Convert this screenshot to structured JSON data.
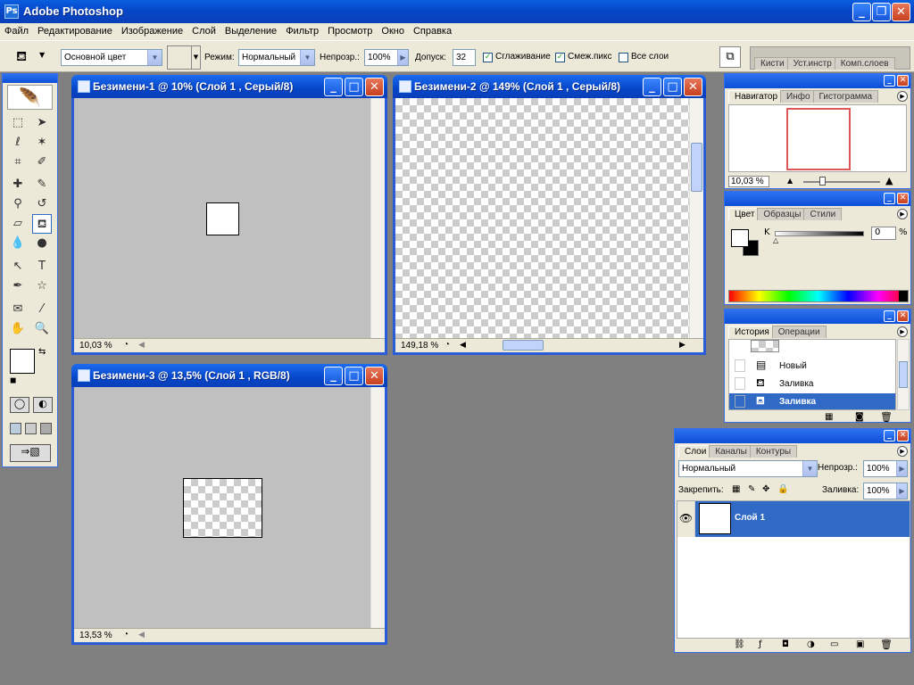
{
  "app": {
    "title": "Adobe Photoshop"
  },
  "menu": [
    "Файл",
    "Редактирование",
    "Изображение",
    "Слой",
    "Выделение",
    "Фильтр",
    "Просмотр",
    "Окно",
    "Справка"
  ],
  "options": {
    "fill_source": "Основной цвет",
    "mode_label": "Режим:",
    "mode_value": "Нормальный",
    "opacity_label": "Непрозр.:",
    "opacity_value": "100%",
    "tolerance_label": "Допуск:",
    "tolerance_value": "32",
    "antialias_label": "Сглаживание",
    "contiguous_label": "Смеж.пикс",
    "all_layers_label": "Все слои",
    "well_tabs": [
      "Кисти",
      "Уст.инстр",
      "Комп.слоев"
    ]
  },
  "documents": [
    {
      "title": "Безимени-1 @ 10% (Слой 1 , Серый/8)",
      "zoom": "10,03 %"
    },
    {
      "title": "Безимени-2 @ 149% (Слой 1 , Серый/8)",
      "zoom": "149,18 %"
    },
    {
      "title": "Безимени-3 @ 13,5% (Слой 1 , RGB/8)",
      "zoom": "13,53 %"
    }
  ],
  "navigator": {
    "tabs": [
      "Навигатор",
      "Инфо",
      "Гистограмма"
    ],
    "zoom": "10,03 %"
  },
  "color": {
    "tabs": [
      "Цвет",
      "Образцы",
      "Стили"
    ],
    "channel": "K",
    "value": "0",
    "unit": "%"
  },
  "history": {
    "tabs": [
      "История",
      "Операции"
    ],
    "items": [
      "Новый",
      "Заливка",
      "Заливка"
    ],
    "selected_index": 2
  },
  "layers": {
    "tabs": [
      "Слои",
      "Каналы",
      "Контуры"
    ],
    "blend_mode": "Нормальный",
    "opacity_label": "Непрозр.:",
    "opacity_value": "100%",
    "lock_label": "Закрепить:",
    "fill_label": "Заливка:",
    "fill_value": "100%",
    "layer_name": "Слой 1"
  },
  "colors": {
    "titlebar": "#0546c8",
    "selection": "#316ac5",
    "panel": "#ece9d8",
    "workspace": "#808080"
  }
}
